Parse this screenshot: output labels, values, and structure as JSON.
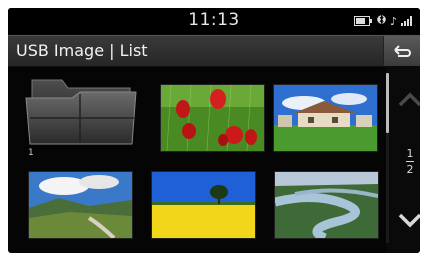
{
  "status": {
    "time": "11:13"
  },
  "header": {
    "title": "USB Image | List"
  },
  "folder": {
    "label": "1"
  },
  "pager": {
    "current": "1",
    "total": "2"
  },
  "thumbnails": [
    "tulips-in-rain",
    "house-on-lawn",
    "mountain-valley-road",
    "tree-in-yellow-field",
    "river-bend-landscape"
  ],
  "icons": {
    "back": "back-arrow-icon",
    "up": "chevron-up-icon",
    "down": "chevron-down-icon",
    "battery": "battery-icon",
    "bluetooth": "bluetooth-icon",
    "music": "music-note-icon",
    "signal": "signal-icon"
  }
}
